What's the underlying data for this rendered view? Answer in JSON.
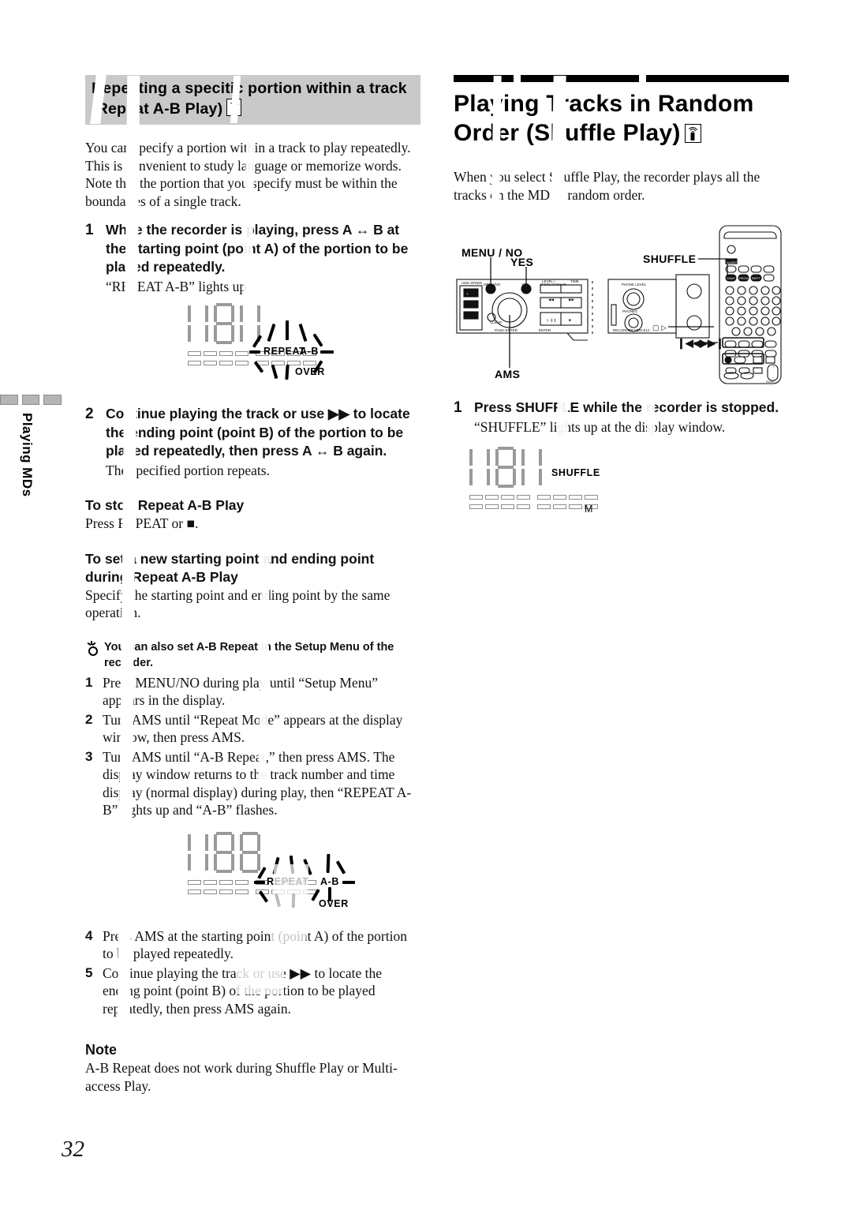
{
  "page": {
    "number": "32",
    "side_tab": "Playing MDs"
  },
  "left_column": {
    "heading": {
      "line1": "Repeating a specitic portion within a track",
      "line2": "(Repeat A-B Play)",
      "icon": "remote-control-icon"
    },
    "intro": "You can specify a portion within a track to play repeatedly. This is convenient to study language or memorize words. Note that the portion that you specify must be within the boundaries of a single track.",
    "steps": [
      {
        "num": "1",
        "bold": "While the recorder is playing, press A ↔ B at the starting point (point A) of the portion to be played repeatedly.",
        "sub": "“REPEAT A-B” lights up"
      },
      {
        "num": "2",
        "bold": "Continue playing the track or use ▶▶ to locate the ending point (point B) of the portion to be played repeatedly, then press A ↔ B again.",
        "sub": "The specified portion repeats."
      }
    ],
    "display_1": {
      "label_repeat": "REPEAT",
      "label_ab": "A-B",
      "label_over": "OVER"
    },
    "stop_section": {
      "heading": "To stop Repeat A-B Play",
      "body": "Press REPEAT or ■."
    },
    "reset_section": {
      "heading_line1": "To set a new starting point and ending point",
      "heading_line2": "during Repeat A-B Play",
      "body": "Specify the starting point and ending point by the same operation."
    },
    "tip": {
      "icon": "tip-sparkle-icon",
      "text": "You can also set A-B Repeat in the Setup Menu of the recorder."
    },
    "tip_steps": [
      {
        "num": "1",
        "text": "Press MENU/NO during play until “Setup Menu” appears in the display."
      },
      {
        "num": "2",
        "text": "Turn AMS until “Repeat Mode” appears at the display window, then press AMS."
      },
      {
        "num": "3",
        "text": "Turn AMS until “A-B Repeat,” then press AMS. The display window returns to the track number and time display (normal display) during play, then “REPEAT A-B” lights up and “A-B” flashes."
      }
    ],
    "display_2": {
      "label_repeat": "REPEAT",
      "label_ab": "A-B",
      "label_over": "OVER"
    },
    "tip_steps_cont": [
      {
        "num": "4",
        "text": "Press AMS at the starting point (point A) of the portion to be played repeatedly."
      },
      {
        "num": "5",
        "text": "Continue playing the track or use ▶▶ to locate the ending point (point B) of the portion to be played repeatedly, then press AMS again."
      }
    ],
    "note": {
      "heading": "Note",
      "body": "A-B Repeat does not work during Shuffle Play or Multi-access Play."
    }
  },
  "right_column": {
    "heading": {
      "line1": "Playing Tracks in Random",
      "line2": "Order (Shuffle Play)",
      "icon": "remote-control-icon"
    },
    "intro": "When you select Shuffle Play, the recorder plays all the tracks on the MD in random order.",
    "figure": {
      "callouts": [
        {
          "name": "menu-no-callout",
          "label": "MENU / NO"
        },
        {
          "name": "yes-callout",
          "label": "YES"
        },
        {
          "name": "ams-callout",
          "label": "AMS"
        },
        {
          "name": "shuffle-callout",
          "label": "SHUFFLE"
        },
        {
          "name": "prev-next-callout",
          "label": "❘◀◀   ▶▶❘"
        }
      ],
      "panel_texts": {
        "model": "RECORDER MDS-E12",
        "phone_level": "PHONE LEVEL",
        "phones": "PHONES"
      }
    },
    "steps": [
      {
        "num": "1",
        "bold": "Press SHUFFLE while the recorder is stopped.",
        "sub": "“SHUFFLE” lights up at the display window."
      }
    ],
    "display": {
      "label_shuffle": "SHUFFLE",
      "label_mono": "M"
    }
  }
}
